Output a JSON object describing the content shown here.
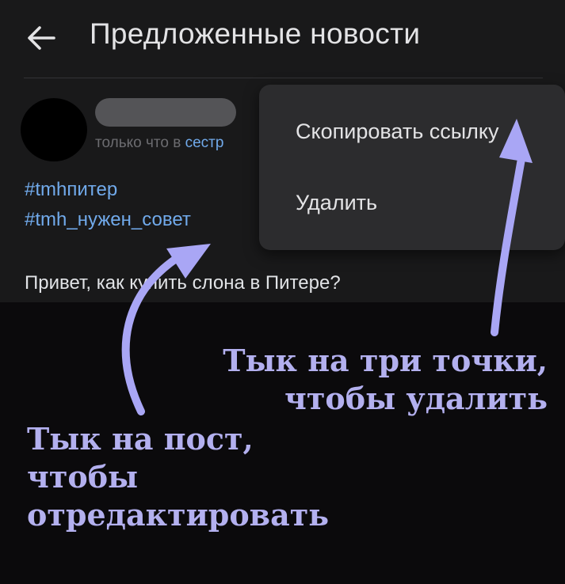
{
  "header": {
    "back_icon": "arrow-left-icon",
    "title": "Предложенные новости"
  },
  "post": {
    "meta_prefix": "только что в ",
    "meta_community": "сестр",
    "hashtags": [
      "#tmhпитер",
      "#tmh_нужен_совет"
    ],
    "text": "Привет, как купить слона в Питере?"
  },
  "menu": {
    "items": [
      {
        "label": "Скопировать ссылку"
      },
      {
        "label": "Удалить"
      }
    ]
  },
  "annotations": {
    "delete": [
      "Тык на три точки,",
      "чтобы удалить"
    ],
    "edit": [
      "Тык на пост,",
      "чтобы",
      "отредактировать"
    ]
  },
  "colors": {
    "background": "#0b0a0c",
    "app_background": "#19191a",
    "menu_background": "#2c2c2e",
    "link": "#71aaeb",
    "annotation": "#b3b0ef",
    "arrow": "#a9a6f5"
  }
}
